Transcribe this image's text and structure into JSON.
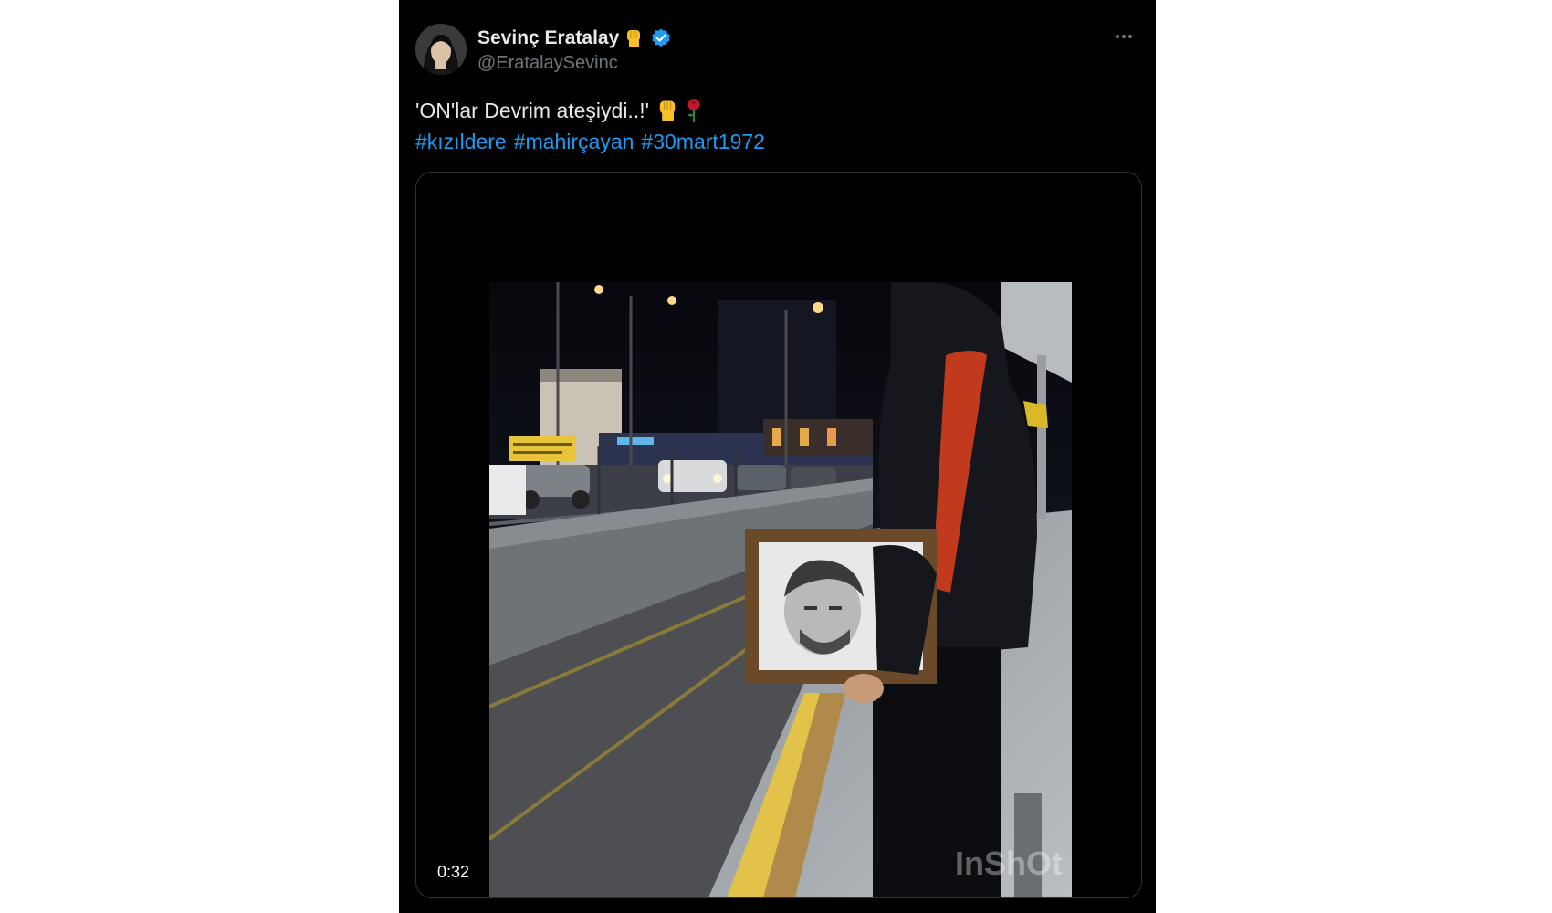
{
  "author": {
    "display_name": "Sevinç Eratalay",
    "handle": "@EratalaySevinc",
    "verified": true
  },
  "tweet": {
    "text": "'ON'lar Devrim ateşiydi..!'",
    "emojis": [
      "raised-fist-emoji",
      "rose-emoji"
    ],
    "hashtags": [
      "#kızıldere",
      "#mahirçayan",
      "#30mart1972"
    ]
  },
  "media": {
    "type": "video",
    "duration": "0:32",
    "watermark": "InShOt"
  },
  "colors": {
    "background": "#000000",
    "text": "#e7e9ea",
    "secondary": "#71767b",
    "link": "#1d9bf0",
    "verified": "#1d9bf0"
  }
}
